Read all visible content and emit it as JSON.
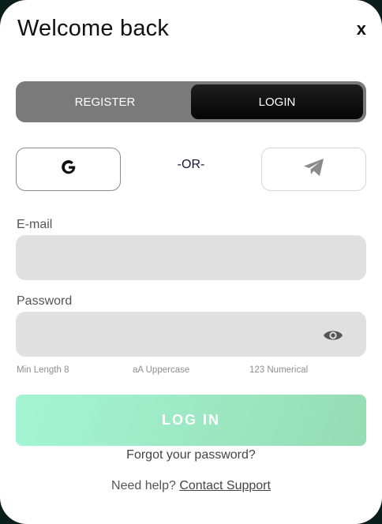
{
  "header": {
    "title": "Welcome back",
    "close_label": "x"
  },
  "tabs": [
    {
      "label": "REGISTER",
      "active": false
    },
    {
      "label": "LOGIN",
      "active": true
    }
  ],
  "social": {
    "google_icon": "google-icon",
    "telegram_icon": "telegram-icon",
    "separator": "-OR-"
  },
  "form": {
    "email_label": "E-mail",
    "email_value": "",
    "password_label": "Password",
    "password_value": "",
    "password_toggle_icon": "eye-icon",
    "hints": [
      "Min Length 8",
      "aA Uppercase",
      "123 Numerical"
    ]
  },
  "actions": {
    "login_label": "LOG IN",
    "forgot_label": "Forgot your password?",
    "help_prefix": "Need help?",
    "help_link": "Contact Support"
  },
  "colors": {
    "tab_track": "#7a7a7a",
    "tab_active": "#0a0a0a",
    "input_bg": "#e0e0e0",
    "login_gradient_start": "#a4f5d5",
    "login_gradient_end": "#96dcb3"
  }
}
